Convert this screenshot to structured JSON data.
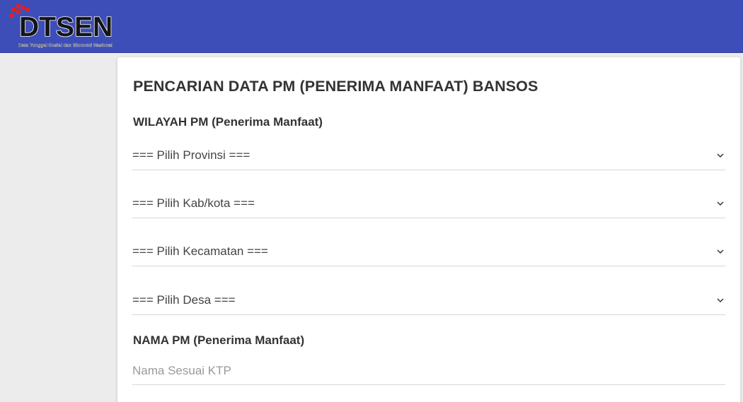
{
  "brand": {
    "name": "DTSEN",
    "tagline": "Data Tunggal Sosial dan Ekonomi Nasional",
    "header_color": "#3d4eb8",
    "logo_accent": "#d8232a"
  },
  "form": {
    "title": "PENCARIAN DATA PM (PENERIMA MANFAAT) BANSOS",
    "wilayah_label": "WILAYAH PM (Penerima Manfaat)",
    "selects": {
      "provinsi": "=== Pilih Provinsi ===",
      "kabkota": "=== Pilih Kab/kota ===",
      "kecamatan": "=== Pilih Kecamatan ===",
      "desa": "=== Pilih Desa ==="
    },
    "nama_label": "NAMA PM (Penerima Manfaat)",
    "nama_placeholder": "Nama Sesuai KTP",
    "nama_value": ""
  },
  "icons": {
    "select_arrow": "chevron-down-icon"
  }
}
